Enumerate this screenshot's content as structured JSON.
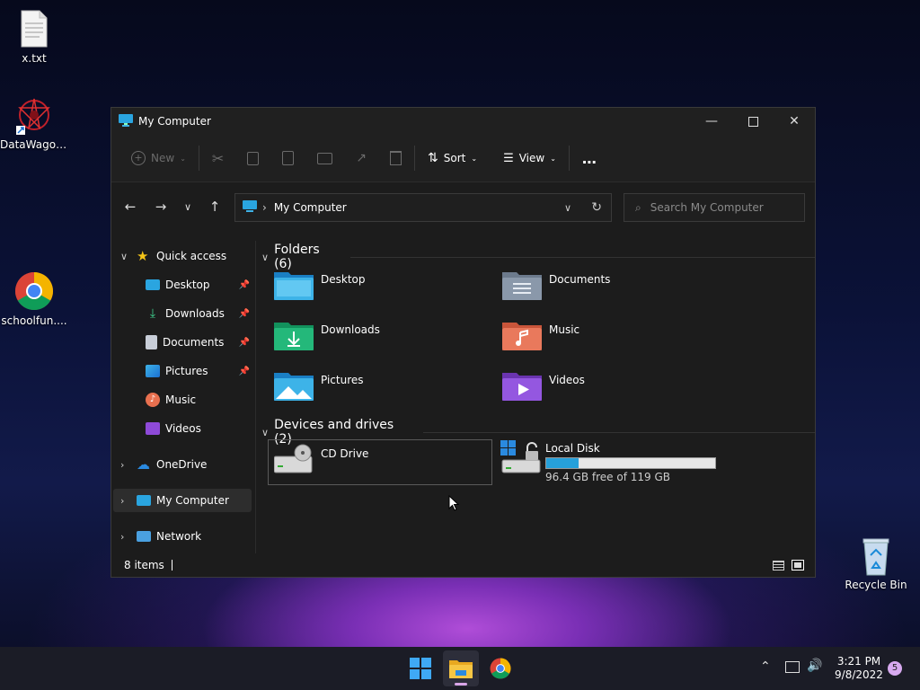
{
  "desktop": {
    "icons": [
      {
        "label": "x.txt"
      },
      {
        "label": "DataWagon..."
      },
      {
        "label": "schoolfun...."
      },
      {
        "label": "Recycle Bin"
      }
    ]
  },
  "window": {
    "title": "My Computer",
    "toolbar": {
      "new_label": "New",
      "sort_label": "Sort",
      "view_label": "View",
      "more_label": "…"
    },
    "address": {
      "location": "My Computer",
      "search_placeholder": "Search My Computer"
    },
    "sidebar": {
      "quick_access": "Quick access",
      "items": [
        {
          "label": "Desktop",
          "pinned": true
        },
        {
          "label": "Downloads",
          "pinned": true
        },
        {
          "label": "Documents",
          "pinned": true
        },
        {
          "label": "Pictures",
          "pinned": true
        },
        {
          "label": "Music",
          "pinned": false
        },
        {
          "label": "Videos",
          "pinned": false
        }
      ],
      "onedrive": "OneDrive",
      "my_computer": "My Computer",
      "network": "Network"
    },
    "content": {
      "folders_header": "Folders (6)",
      "folders": [
        {
          "name": "Desktop"
        },
        {
          "name": "Documents"
        },
        {
          "name": "Downloads"
        },
        {
          "name": "Music"
        },
        {
          "name": "Pictures"
        },
        {
          "name": "Videos"
        }
      ],
      "devices_header": "Devices and drives (2)",
      "drives": [
        {
          "name": "CD Drive"
        },
        {
          "name": "Local Disk",
          "free_text": "96.4 GB free of 119 GB",
          "used_fraction": 0.19
        }
      ]
    },
    "statusbar": {
      "items_text": "8 items"
    }
  },
  "taskbar": {
    "time": "3:21 PM",
    "date": "9/8/2022",
    "notifications": "5"
  },
  "colors": {
    "accent": "#0078d4",
    "window_bg": "#1c1c1c",
    "taskbar_bg": "#1b1c26"
  }
}
